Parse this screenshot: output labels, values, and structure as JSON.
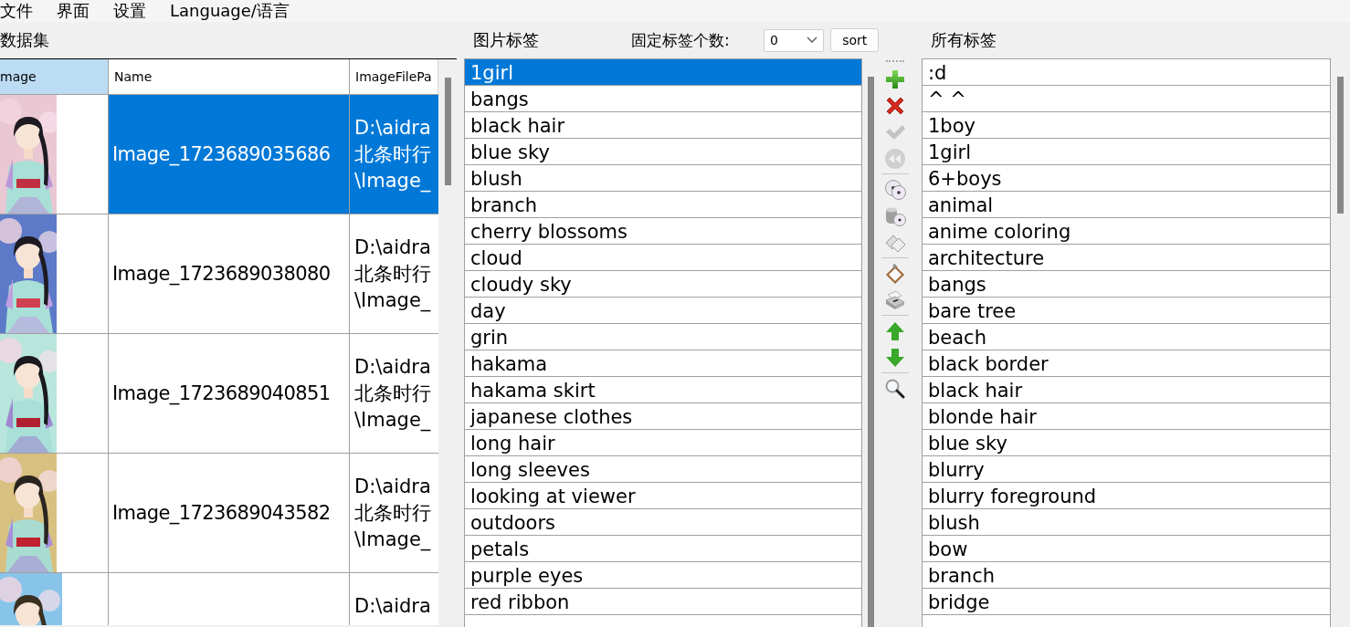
{
  "menu": [
    {
      "label": "文件"
    },
    {
      "label": "界面"
    },
    {
      "label": "设置"
    },
    {
      "label": "Language/语言"
    }
  ],
  "dataset": {
    "title": "数据集",
    "table": {
      "columns": [
        {
          "label": "mage",
          "highlighted": true
        },
        {
          "label": "Name",
          "highlighted": false
        },
        {
          "label": "ImageFilePa",
          "highlighted": false
        }
      ],
      "rows": [
        {
          "selected": true,
          "picture": {
            "kind": "picture"
          },
          "name": "Image_1723689035686",
          "path": [
            "D:\\aidra",
            "北条时行",
            "\\Image_"
          ]
        },
        {
          "selected": false,
          "picture": {
            "kind": "picture"
          },
          "name": "Image_1723689038080",
          "path": [
            "D:\\aidra",
            "北条时行",
            "\\Image_"
          ]
        },
        {
          "selected": false,
          "picture": {
            "kind": "picture"
          },
          "name": "Image_1723689040851",
          "path": [
            "D:\\aidra",
            "北条时行",
            "\\Image_"
          ]
        },
        {
          "selected": false,
          "picture": {
            "kind": "picture"
          },
          "name": "Image_1723689043582",
          "path": [
            "D:\\aidra",
            "北条时行",
            "\\Image_"
          ]
        },
        {
          "selected": false,
          "picture": {
            "kind": "picture"
          },
          "path": [
            "D:\\aidra"
          ]
        }
      ]
    }
  },
  "image_tags": {
    "title": "图片标签",
    "fixed_count_label": "固定标签个数:",
    "fixed_count": "0",
    "sort_button": "sort",
    "tags": [
      {
        "label": "1girl",
        "selected": true
      },
      {
        "label": "bangs",
        "selected": false
      },
      {
        "label": "black hair",
        "selected": false
      },
      {
        "label": "blue sky",
        "selected": false
      },
      {
        "label": "blush",
        "selected": false
      },
      {
        "label": "branch",
        "selected": false
      },
      {
        "label": "cherry blossoms",
        "selected": false
      },
      {
        "label": "cloud",
        "selected": false
      },
      {
        "label": "cloudy sky",
        "selected": false
      },
      {
        "label": "day",
        "selected": false
      },
      {
        "label": "grin",
        "selected": false
      },
      {
        "label": "hakama",
        "selected": false
      },
      {
        "label": "hakama skirt",
        "selected": false
      },
      {
        "label": "japanese clothes",
        "selected": false
      },
      {
        "label": "long hair",
        "selected": false
      },
      {
        "label": "long sleeves",
        "selected": false
      },
      {
        "label": "looking at viewer",
        "selected": false
      },
      {
        "label": "outdoors",
        "selected": false
      },
      {
        "label": "petals",
        "selected": false
      },
      {
        "label": "purple eyes",
        "selected": false
      },
      {
        "label": "red ribbon",
        "selected": false
      }
    ]
  },
  "toolbar": [
    [
      {
        "kind": "add",
        "disabled": false
      },
      {
        "kind": "remove",
        "disabled": false
      },
      {
        "kind": "check",
        "disabled": true
      },
      {
        "kind": "rewind",
        "disabled": true
      }
    ],
    [
      {
        "kind": "discs",
        "disabled": false
      },
      {
        "kind": "database",
        "disabled": false
      },
      {
        "kind": "copy",
        "disabled": false
      }
    ],
    [
      {
        "kind": "clipboard",
        "disabled": false
      },
      {
        "kind": "printer",
        "disabled": false
      }
    ],
    [
      {
        "kind": "up",
        "disabled": false
      },
      {
        "kind": "down",
        "disabled": false
      }
    ],
    [
      {
        "kind": "search",
        "disabled": false
      }
    ]
  ],
  "all_tags": {
    "title": "所有标签",
    "tags": [
      {
        "label": ":d",
        "selected": false
      },
      {
        "label": "^ ^",
        "selected": false
      },
      {
        "label": "1boy",
        "selected": false
      },
      {
        "label": "1girl",
        "selected": false
      },
      {
        "label": "6+boys",
        "selected": false
      },
      {
        "label": "animal",
        "selected": false
      },
      {
        "label": "anime coloring",
        "selected": false
      },
      {
        "label": "architecture",
        "selected": false
      },
      {
        "label": "bangs",
        "selected": false
      },
      {
        "label": "bare tree",
        "selected": false
      },
      {
        "label": "beach",
        "selected": false
      },
      {
        "label": "black border",
        "selected": false
      },
      {
        "label": "black hair",
        "selected": false
      },
      {
        "label": "blonde hair",
        "selected": false
      },
      {
        "label": "blue sky",
        "selected": false
      },
      {
        "label": "blurry",
        "selected": false
      },
      {
        "label": "blurry foreground",
        "selected": false
      },
      {
        "label": "blush",
        "selected": false
      },
      {
        "label": "bow",
        "selected": false
      },
      {
        "label": "branch",
        "selected": false
      },
      {
        "label": "bridge",
        "selected": false
      }
    ]
  }
}
